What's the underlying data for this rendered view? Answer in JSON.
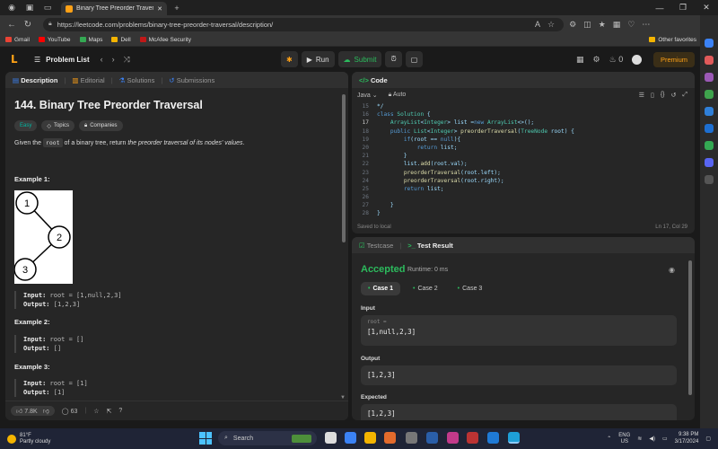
{
  "browser": {
    "tab_title": "Binary Tree Preorder Traversal - L",
    "url": "https://leetcode.com/problems/binary-tree-preorder-traversal/description/",
    "bookmarks": [
      {
        "label": "Gmail",
        "color": "#ea4335"
      },
      {
        "label": "YouTube",
        "color": "#ff0000"
      },
      {
        "label": "Maps",
        "color": "#34a853"
      },
      {
        "label": "Dell",
        "color": "#f4b400"
      },
      {
        "label": "McAfee Security",
        "color": "#c01818"
      }
    ],
    "other_favorites": "Other favorites"
  },
  "nav": {
    "problem_list": "Problem List",
    "run": "Run",
    "submit": "Submit",
    "streak": "0",
    "premium": "Premium"
  },
  "left_panel": {
    "tabs": [
      "Description",
      "Editorial",
      "Solutions",
      "Submissions"
    ],
    "title": "144. Binary Tree Preorder Traversal",
    "tags": [
      "Easy",
      "Topics",
      "Companies"
    ],
    "desc_pre": "Given the",
    "desc_code": "root",
    "desc_mid": "of a binary tree, return",
    "desc_italic": "the preorder traversal of its nodes' values",
    "desc_end": ".",
    "tree_nodes": [
      "1",
      "2",
      "3"
    ],
    "examples": [
      {
        "heading": "Example 1:",
        "input": "root = [1,null,2,3]",
        "output": "[1,2,3]"
      },
      {
        "heading": "Example 2:",
        "input": "root = []",
        "output": "[]"
      },
      {
        "heading": "Example 3:",
        "input": "root = [1]",
        "output": "[1]"
      }
    ],
    "input_label": "Input:",
    "output_label": "Output:",
    "likes": "7.8K",
    "comments": "63"
  },
  "code_panel": {
    "title": "Code",
    "language": "Java",
    "mode": "Auto",
    "saved": "Saved to local",
    "cursor": "Ln 17, Col 29",
    "active_line": 17,
    "lines": [
      {
        "n": 15,
        "text": "*/"
      },
      {
        "n": 16,
        "text": "class Solution {"
      },
      {
        "n": 17,
        "text": "    ArrayList<Integer> list =new ArrayList<>();"
      },
      {
        "n": 18,
        "text": "    public List<Integer> preorderTraversal(TreeNode root) {"
      },
      {
        "n": 19,
        "text": "        if(root == null){"
      },
      {
        "n": 20,
        "text": "            return list;"
      },
      {
        "n": 21,
        "text": "        }"
      },
      {
        "n": 22,
        "text": "        list.add(root.val);"
      },
      {
        "n": 23,
        "text": "        preorderTraversal(root.left);"
      },
      {
        "n": 24,
        "text": "        preorderTraversal(root.right);"
      },
      {
        "n": 25,
        "text": "        return list;"
      },
      {
        "n": 26,
        "text": ""
      },
      {
        "n": 27,
        "text": "    }"
      },
      {
        "n": 28,
        "text": "}"
      }
    ]
  },
  "result_panel": {
    "tabs": [
      "Testcase",
      "Test Result"
    ],
    "status": "Accepted",
    "runtime": "Runtime: 0 ms",
    "cases": [
      "Case 1",
      "Case 2",
      "Case 3"
    ],
    "input_label": "Input",
    "input_var": "root =",
    "input_value": "[1,null,2,3]",
    "output_label": "Output",
    "output_value": "[1,2,3]",
    "expected_label": "Expected",
    "expected_value": "[1,2,3]"
  },
  "taskbar": {
    "temp": "81°F",
    "weather": "Partly cloudy",
    "search": "Search",
    "lang1": "ENG",
    "lang2": "US",
    "time": "9:38 PM",
    "date": "3/17/2024"
  }
}
